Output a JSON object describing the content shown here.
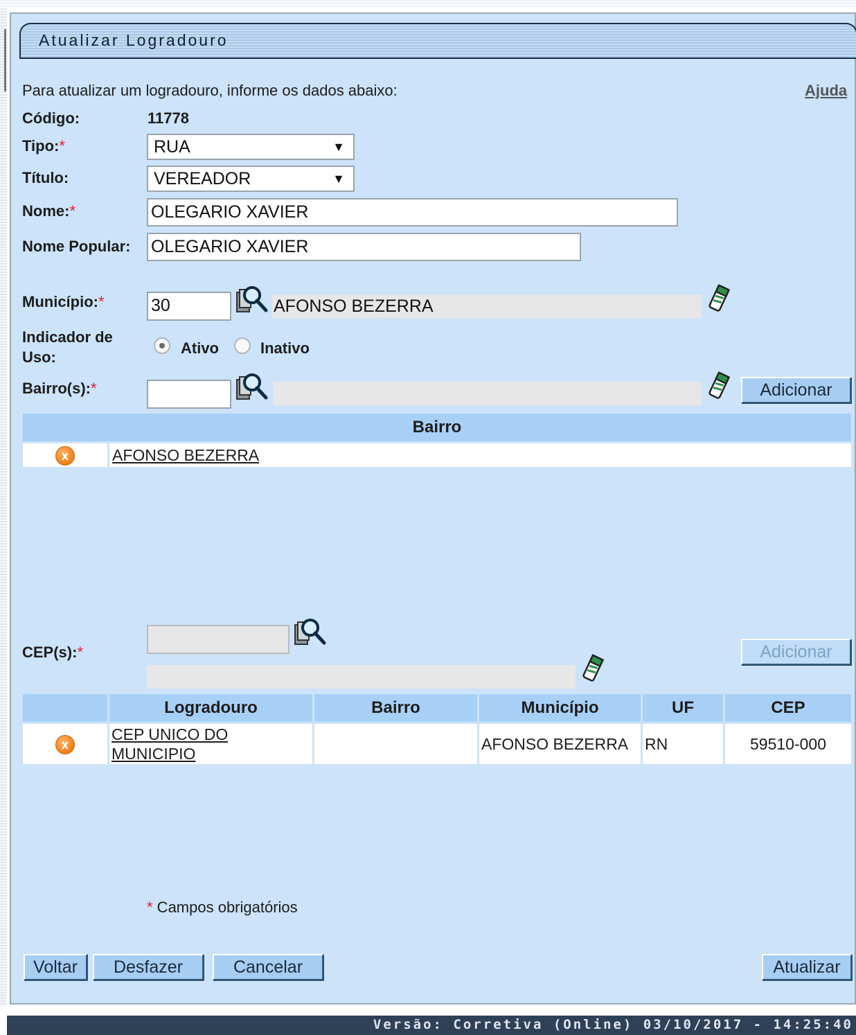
{
  "page": {
    "title": "Atualizar Logradouro",
    "intro": "Para atualizar um logradouro, informe os dados abaixo:",
    "help_link": "Ajuda"
  },
  "form": {
    "codigo": {
      "label": "Código:",
      "value": "11778"
    },
    "tipo": {
      "label": "Tipo:",
      "required_mark": "*",
      "selected": "RUA"
    },
    "titulo": {
      "label": "Título:",
      "selected": "VEREADOR"
    },
    "nome": {
      "label": "Nome:",
      "required_mark": "*",
      "value": "OLEGARIO XAVIER"
    },
    "nome_popular": {
      "label": "Nome Popular:",
      "value": "OLEGARIO XAVIER"
    },
    "municipio": {
      "label": "Município:",
      "required_mark": "*",
      "code": "30",
      "name": "AFONSO BEZERRA"
    },
    "indicador_uso": {
      "label_line1": "Indicador de",
      "label_line2": "Uso:",
      "options": [
        "Ativo",
        "Inativo"
      ],
      "selected": "Ativo"
    },
    "bairros": {
      "label": "Bairro(s):",
      "required_mark": "*",
      "code": "",
      "name": "",
      "add_button": "Adicionar"
    },
    "ceps": {
      "label": "CEP(s):",
      "required_mark": "*",
      "code": "",
      "description": "",
      "add_button": "Adicionar"
    }
  },
  "bairro_table": {
    "header": "Bairro",
    "rows": [
      {
        "remove_icon": "remove-x-icon",
        "bairro": "AFONSO BEZERRA"
      }
    ]
  },
  "cep_table": {
    "headers": [
      "Logradouro",
      "Bairro",
      "Município",
      "UF",
      "CEP"
    ],
    "rows": [
      {
        "remove_icon": "remove-x-icon",
        "logradouro_line1": "CEP UNICO DO",
        "logradouro_line2": "MUNICIPIO",
        "bairro": "",
        "municipio": "AFONSO BEZERRA",
        "uf": "RN",
        "cep": "59510-000"
      }
    ]
  },
  "required_note": {
    "mark": "*",
    "text": " Campos obrigatórios"
  },
  "buttons": {
    "voltar": "Voltar",
    "desfazer": "Desfazer",
    "cancelar": "Cancelar",
    "atualizar": "Atualizar"
  },
  "footer": {
    "version": "Versão: Corretiva (Online) 03/10/2017 - 14:25:40"
  },
  "colors": {
    "panel_bg": "#cce3f9",
    "table_header_bg": "#a8d0f7",
    "button_bg": "#a7cdf3",
    "footer_bg": "#2e4157",
    "required_red": "#e0202e",
    "remove_orange": "#f07f12"
  },
  "icons": {
    "search": "magnifier-search-icon",
    "clear": "eraser-clear-icon",
    "remove": "remove-x-icon"
  }
}
